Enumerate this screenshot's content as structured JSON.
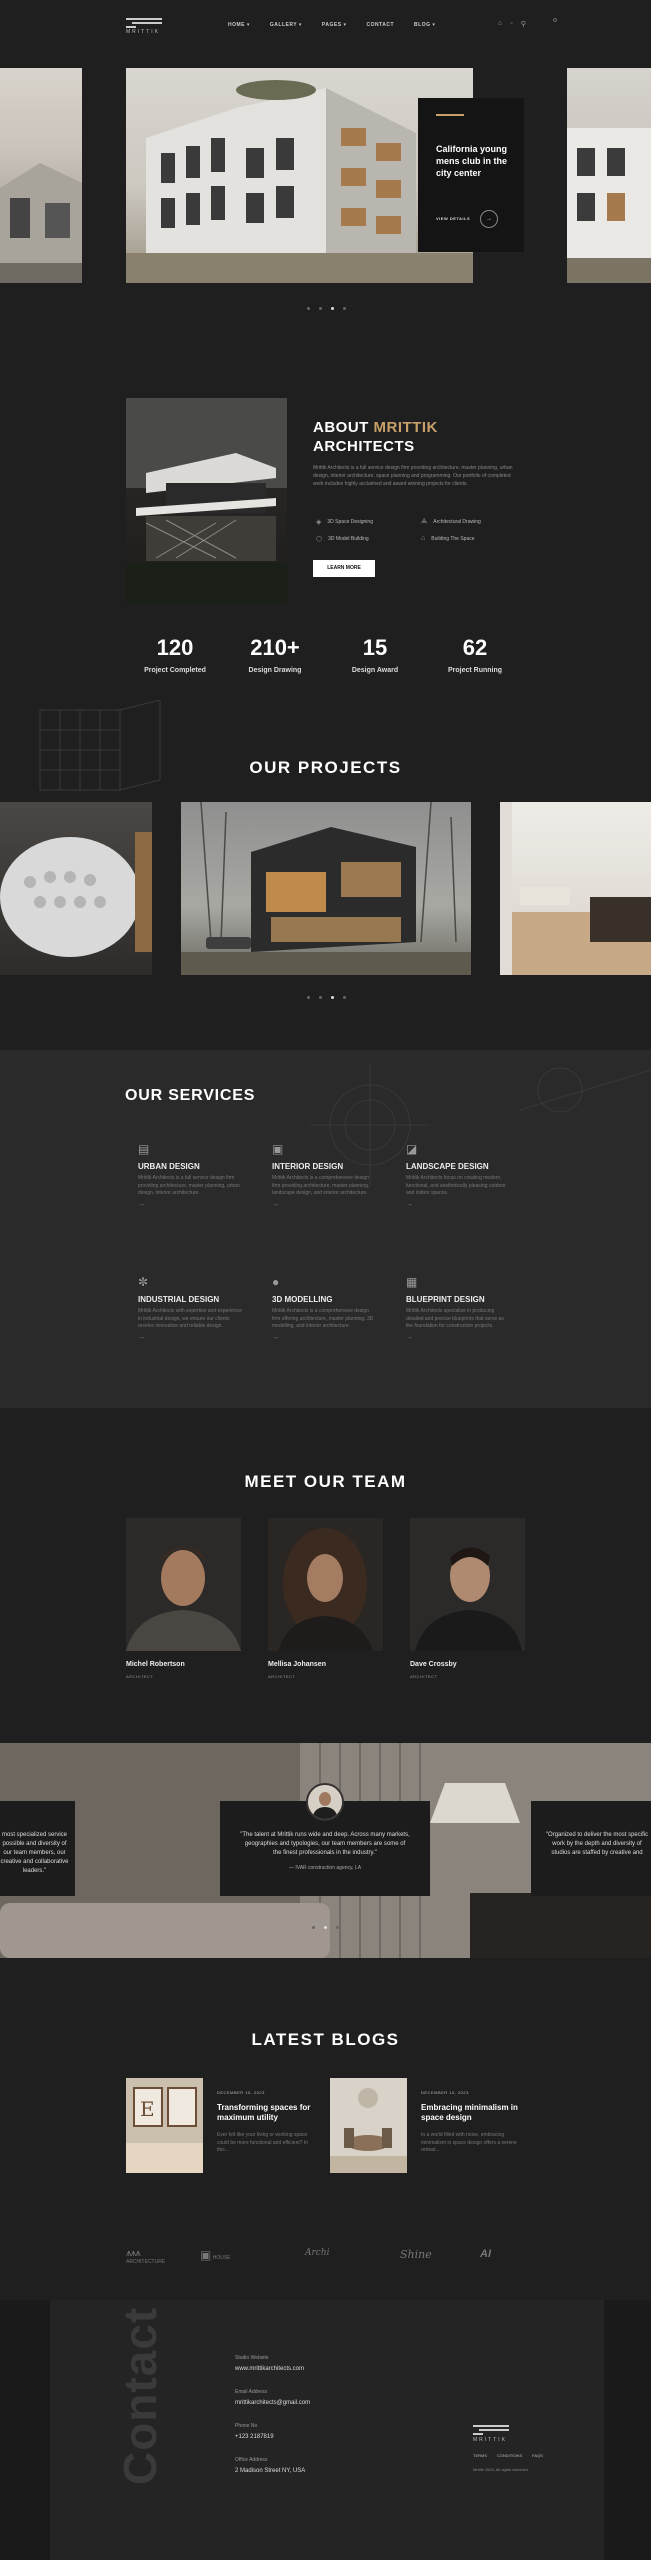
{
  "header": {
    "logo_text": "MRITTIK",
    "nav": [
      "HOME ▾",
      "GALLERY ▾",
      "PAGES ▾",
      "CONTACT",
      "BLOG ▾"
    ]
  },
  "hero": {
    "card_title": "California young mens club in the city center",
    "card_link": "VIEW DETAILS"
  },
  "about": {
    "title_1": "ABOUT",
    "title_highlight": "MRITTIK",
    "title_2": "ARCHITECTS",
    "text": "Mrittik Architects is a full service design firm providing architecture, master planning, urban design, interior architecture, space planning and programming. Our portfolio of completed work includes highly acclaimed and award winning projects for clients.",
    "features": [
      "3D Space Designing",
      "Architectural Drawing",
      "3D Model Building",
      "Building The Space"
    ],
    "button": "LEARN MORE",
    "stats": [
      {
        "num": "120",
        "label": "Project Completed"
      },
      {
        "num": "210+",
        "label": "Design Drawing"
      },
      {
        "num": "15",
        "label": "Design Award"
      },
      {
        "num": "62",
        "label": "Project Running"
      }
    ]
  },
  "projects": {
    "title": "OUR PROJECTS"
  },
  "services": {
    "title": "OUR SERVICES",
    "items": [
      {
        "title": "URBAN DESIGN",
        "text": "Mrittik Architects is a full service design firm providing architecture, master planning, urban design, interior architecture."
      },
      {
        "title": "INTERIOR DESIGN",
        "text": "Mrittik Architects is a comprehensive design firm providing architecture, master planning, landscape design, and interior architecture."
      },
      {
        "title": "LANDSCAPE DESIGN",
        "text": "Mrittik Architects focus on creating modern, functional, and aesthetically pleasing outdoor and indoor spaces."
      },
      {
        "title": "INDUSTRIAL DESIGN",
        "text": "Mrittik Architects with expertise and experience in industrial design, we ensure our clients receive innovative and reliable design."
      },
      {
        "title": "3D MODELLING",
        "text": "Mrittik Architects is a comprehensive design firm offering architecture, master planning, 3D modelling, and interior architecture."
      },
      {
        "title": "BLUEPRINT DESIGN",
        "text": "Mrittik Architects specialize in producing detailed and precise blueprints that serve as the foundation for construction projects."
      }
    ]
  },
  "team": {
    "title": "MEET OUR TEAM",
    "members": [
      {
        "name": "Michel Robertson",
        "role": "ARCHITECT"
      },
      {
        "name": "Mellisa Johansen",
        "role": "ARCHITECT"
      },
      {
        "name": "Dave Crossby",
        "role": "ARCHITECT"
      }
    ]
  },
  "testimonial": {
    "left_text": "most specialized service possible and diversity of our team members, our creative and collaborative leaders.\"",
    "main_text": "\"The talent at Mrittik runs wide and deep. Across many markets, geographies and typologies, our team members are some of the finest professionals in the industry.\"",
    "main_author": "— IVAR construction agency, LA",
    "right_text": "\"Organized to deliver the most specific work by the depth and diversity of studios are staffed by creative and"
  },
  "blogs": {
    "title": "LATEST BLOGS",
    "items": [
      {
        "date": "DECEMBER 10, 2023",
        "title": "Transforming spaces for maximum utility",
        "text": "Ever felt like your living or working space could be more functional and efficient? In this..."
      },
      {
        "date": "DECEMBER 10, 2023",
        "title": "Embracing minimalism in space design",
        "text": "In a world filled with noise, embracing minimalism in space design offers a serene retreat..."
      }
    ]
  },
  "partners": [
    "ARCHITECTURE",
    "HOUSE",
    "Archi",
    "Shine",
    "AI"
  ],
  "contact": {
    "vertical": "Contact",
    "fields": [
      {
        "label": "Studio Website",
        "value": "www.mrittikarchitects.com"
      },
      {
        "label": "Email Address",
        "value": "mrittikarchitects@gmail.com"
      },
      {
        "label": "Phone No",
        "value": "+123 2187819"
      },
      {
        "label": "Office Address",
        "value": "2 Madison Street NY, USA"
      }
    ],
    "footer_logo": "MRITTIK",
    "footer_links": [
      "TERMS",
      "CONDITIONS",
      "FAQS"
    ],
    "copyright": "Mrittik 2024, All rights reserved"
  },
  "colors": {
    "accent": "#c8a06a",
    "bg": "#1f1f1f"
  }
}
